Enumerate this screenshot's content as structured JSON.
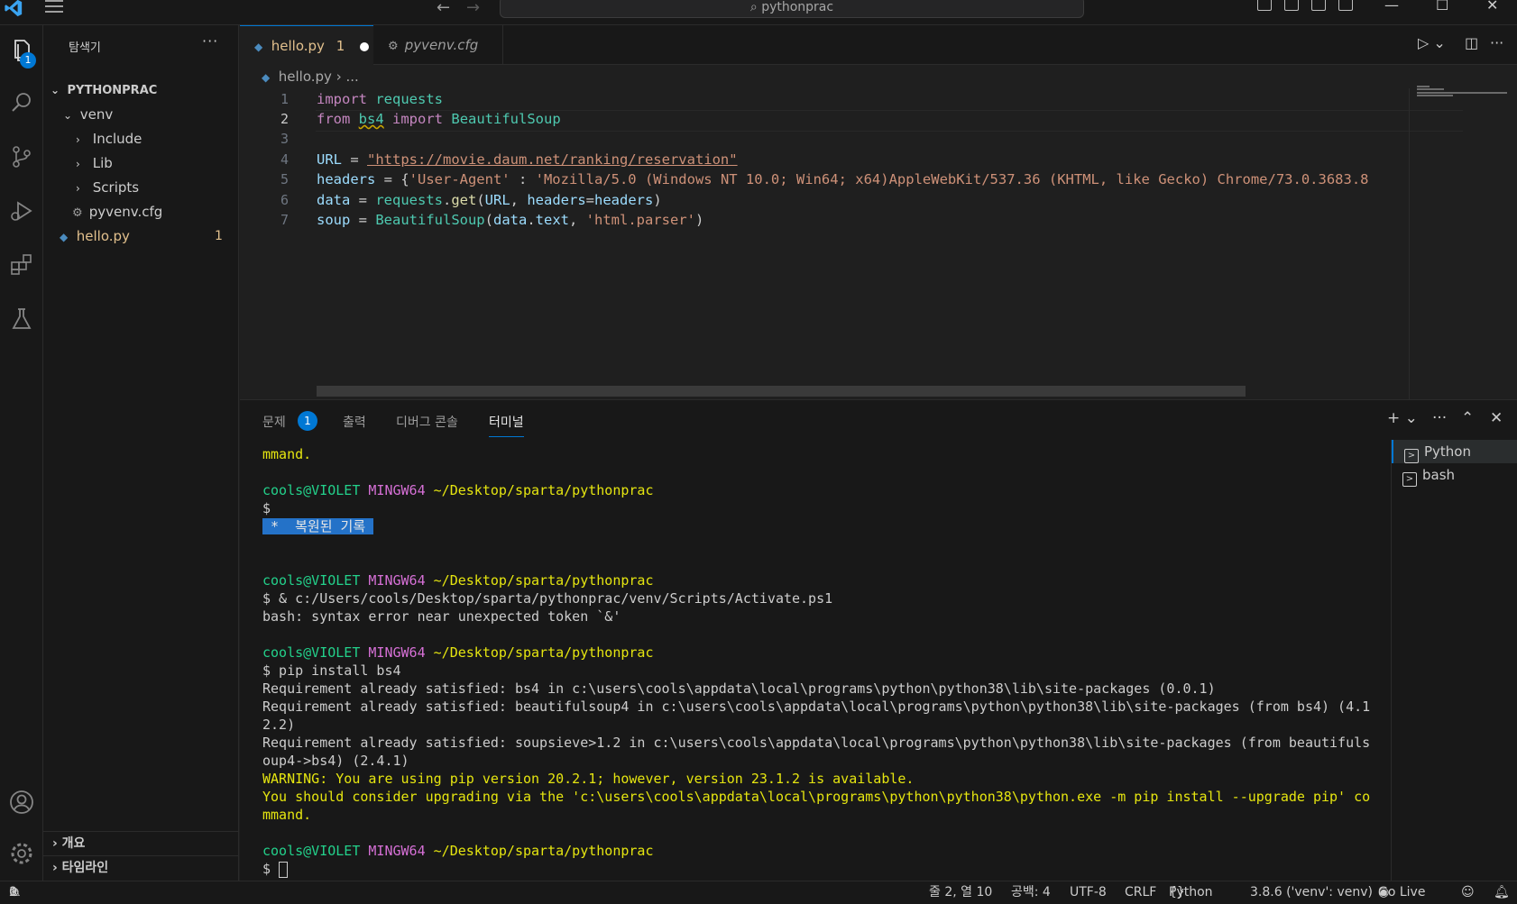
{
  "titlebar": {
    "search_text": "pythonprac",
    "icons": [
      "vscode-logo",
      "menu-icon",
      "arrow-left-icon",
      "arrow-right-icon",
      "search-icon",
      "toggle-sidebar-icon",
      "toggle-panel-icon",
      "toggle-secondary-icon",
      "customize-layout-icon",
      "minimize-icon",
      "maximize-icon",
      "close-icon"
    ]
  },
  "activity": {
    "explorer_badge": "1",
    "icons": [
      "explorer-icon",
      "search-icon",
      "source-control-icon",
      "run-debug-icon",
      "extensions-icon",
      "testing-icon",
      "accounts-icon",
      "settings-gear-icon"
    ]
  },
  "sidebar": {
    "title": "탐색기",
    "more": "···",
    "root": "PYTHONPRAC",
    "items": [
      {
        "label": "venv"
      },
      {
        "label": "Include"
      },
      {
        "label": "Lib"
      },
      {
        "label": "Scripts"
      },
      {
        "label": "pyvenv.cfg"
      },
      {
        "label": "hello.py",
        "count": "1"
      }
    ],
    "outline": "개요",
    "timeline": "타임라인"
  },
  "tabs": [
    {
      "label": "hello.py",
      "problems": "1"
    },
    {
      "label": "pyvenv.cfg"
    }
  ],
  "breadcrumb": {
    "file": "hello.py",
    "rest": "..."
  },
  "editor": {
    "line_numbers": [
      "1",
      "2",
      "3",
      "4",
      "5",
      "6",
      "7"
    ],
    "lines": {
      "l1": {
        "kw": "import",
        "mod": "requests"
      },
      "l2": {
        "kw1": "from",
        "mod": "bs4",
        "kw2": "import",
        "cls": "BeautifulSoup"
      },
      "l4": {
        "var": "URL",
        "op": " = ",
        "str": "\"https://movie.daum.net/ranking/reservation\""
      },
      "l5": {
        "var": "headers",
        "op": " = {",
        "key": "'User-Agent'",
        "colon": " : ",
        "val": "'Mozilla/5.0 (Windows NT 10.0; Win64; x64)AppleWebKit/537.36 (KHTML, like Gecko) Chrome/73.0.3683.8"
      },
      "l6": {
        "var": "data",
        "op": " = ",
        "mod": "requests",
        "dot": ".",
        "fn": "get",
        "p1": "(",
        "arg1": "URL",
        "comma": ", ",
        "arg2": "headers",
        "eq": "=",
        "arg3": "headers",
        "p2": ")"
      },
      "l7": {
        "var": "soup",
        "op": " = ",
        "cls": "BeautifulSoup",
        "p1": "(",
        "arg1": "data",
        "dot": ".",
        "arg2": "text",
        "comma": ", ",
        "str": "'html.parser'",
        "p2": ")"
      }
    }
  },
  "panel": {
    "tabs": {
      "problems": "문제",
      "problems_badge": "1",
      "output": "출력",
      "debug": "디버그 콘솔",
      "terminal": "터미널"
    },
    "terminals": [
      "Python",
      "bash"
    ],
    "term": {
      "l0": "mmand.",
      "user": "cools@VIOLET",
      "host": "MINGW64",
      "path": "~/Desktop/sparta/pythonprac",
      "prompt": "$",
      "restored": " *  복원된 기록 ",
      "cmd1": "$ & c:/Users/cools/Desktop/sparta/pythonprac/venv/Scripts/Activate.ps1",
      "err1": "bash: syntax error near unexpected token `&'",
      "cmd2": "$ pip install bs4",
      "req1": "Requirement already satisfied: bs4 in c:\\users\\cools\\appdata\\local\\programs\\python\\python38\\lib\\site-packages (0.0.1)",
      "req2a": "Requirement already satisfied: beautifulsoup4 in c:\\users\\cools\\appdata\\local\\programs\\python\\python38\\lib\\site-packages (from bs4) (4.1",
      "req2b": "2.2)",
      "req3a": "Requirement already satisfied: soupsieve>1.2 in c:\\users\\cools\\appdata\\local\\programs\\python\\python38\\lib\\site-packages (from beautifuls",
      "req3b": "oup4->bs4) (2.4.1)",
      "warn1": "WARNING: You are using pip version 20.2.1; however, version 23.1.2 is available.",
      "warn2": "You should consider upgrading via the 'c:\\users\\cools\\appdata\\local\\programs\\python\\python38\\python.exe -m pip install --upgrade pip' co",
      "warn3": "mmand.",
      "last_prompt": "$ "
    }
  },
  "status": {
    "errors": "0",
    "warnings": "1",
    "position": "줄 2, 열 10",
    "spaces": "공백: 4",
    "encoding": "UTF-8",
    "eol": "CRLF",
    "language": "Python",
    "interpreter": "3.8.6 ('venv': venv)",
    "golive": "Go Live"
  },
  "colors": {
    "accent": "#0078d4",
    "modified": "#e2c08d",
    "term_green": "#23d18b",
    "term_magenta": "#d670d6",
    "term_yellow": "#e5e510"
  }
}
